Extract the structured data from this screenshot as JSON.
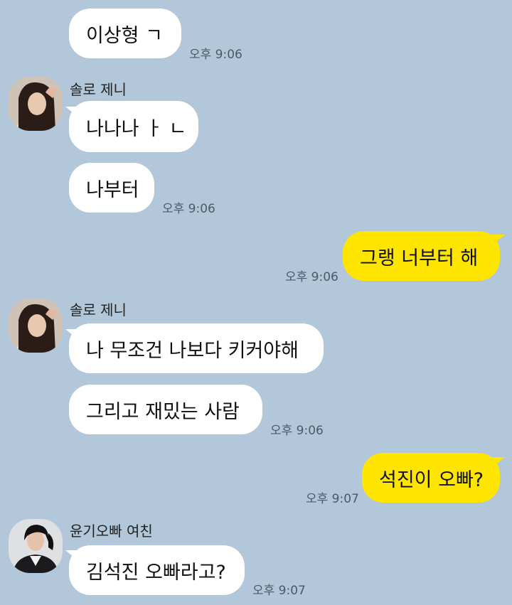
{
  "messages": {
    "m1": {
      "text": "이상형 ㄱ",
      "time": "오후 9:06"
    },
    "g1": {
      "sender": "솔로 제니",
      "avatar": "jennie-avatar",
      "m2": {
        "text": "나나나 ㅏ ㄴ"
      },
      "m3": {
        "text": "나부터",
        "time": "오후 9:06"
      }
    },
    "m4": {
      "text": "그랭 너부터 해",
      "time": "오후 9:06"
    },
    "g2": {
      "sender": "솔로 제니",
      "avatar": "jennie-avatar",
      "m5": {
        "text": "나 무조건 나보다 키커야해"
      },
      "m6": {
        "text": "그리고 재밌는 사람",
        "time": "오후 9:06"
      }
    },
    "m7": {
      "text": "석진이 오빠?",
      "time": "오후 9:07"
    },
    "g3": {
      "sender": "윤기오빠 여친",
      "avatar": "girl-avatar",
      "m8": {
        "text": "김석진 오빠라고?",
        "time": "오후 9:07"
      }
    }
  },
  "colors": {
    "background": "#b2c7d9",
    "incoming_bubble": "#ffffff",
    "outgoing_bubble": "#fee500"
  }
}
